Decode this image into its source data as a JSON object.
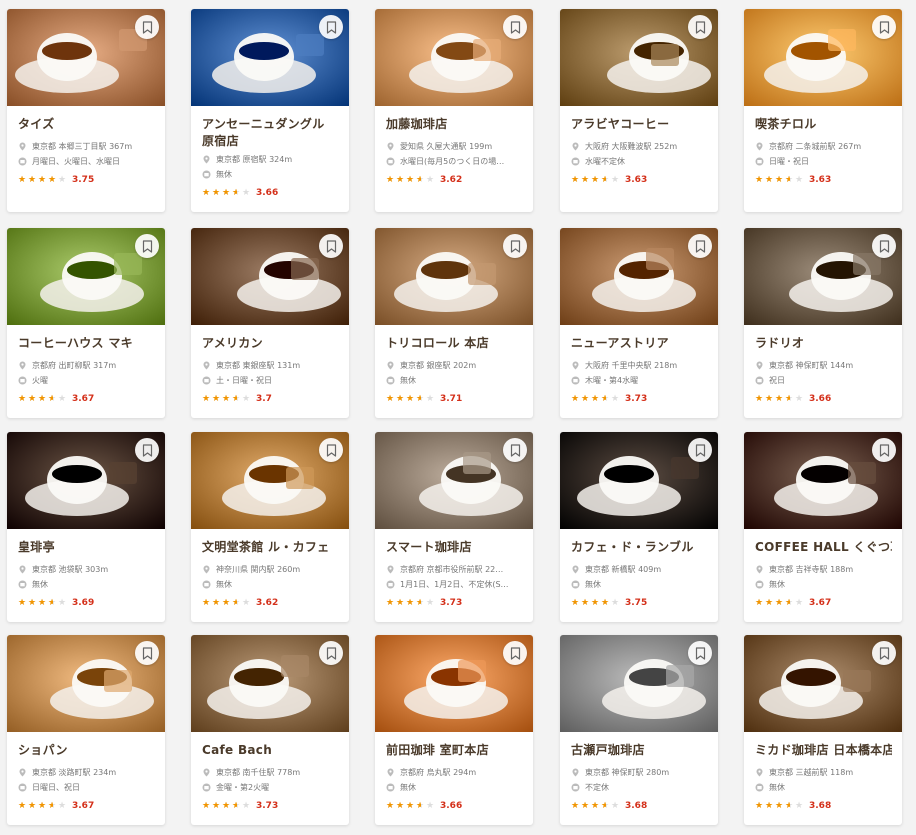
{
  "colors": {
    "star": "#f29500",
    "score": "#d4301a",
    "name": "#4a3a2a",
    "meta": "#777777"
  },
  "icons": {
    "location": "location-pin-icon",
    "holiday": "calendar-icon",
    "bookmark": "bookmark-icon",
    "star": "star-icon"
  },
  "shops": [
    {
      "name": "タイズ",
      "location": "東京都 本郷三丁目駅 367m",
      "holiday": "月曜日、火曜日、水曜日",
      "rating": 3.75,
      "rating_text": "3.75",
      "photo": "#b47a52"
    },
    {
      "name": "アンセーニュダングル 原宿店",
      "location": "東京都 原宿駅 324m",
      "holiday": "無休",
      "rating": 3.66,
      "rating_text": "3.66",
      "photo": "#2f5fa2"
    },
    {
      "name": "加藤珈琲店",
      "location": "愛知県 久屋大通駅 199m",
      "holiday": "水曜日(毎月5のつく日の場…",
      "rating": 3.62,
      "rating_text": "3.62",
      "photo": "#c98f5a"
    },
    {
      "name": "アラビヤコーヒー",
      "location": "大阪府 大阪難波駅 252m",
      "holiday": "水曜不定休",
      "rating": 3.63,
      "rating_text": "3.63",
      "photo": "#8a6a3c"
    },
    {
      "name": "喫茶チロル",
      "location": "京都府 二条城前駅 267m",
      "holiday": "日曜・祝日",
      "rating": 3.63,
      "rating_text": "3.63",
      "photo": "#e89a40"
    },
    {
      "name": "コーヒーハウス マキ",
      "location": "京都府 出町柳駅 317m",
      "holiday": "火曜",
      "rating": 3.67,
      "rating_text": "3.67",
      "photo": "#7a9a3a"
    },
    {
      "name": "アメリカン",
      "location": "東京都 東銀座駅 131m",
      "holiday": "土・日曜・祝日",
      "rating": 3.7,
      "rating_text": "3.7",
      "photo": "#6a4a32"
    },
    {
      "name": "トリコロール 本店",
      "location": "東京都 銀座駅 202m",
      "holiday": "無休",
      "rating": 3.71,
      "rating_text": "3.71",
      "photo": "#a57a52"
    },
    {
      "name": "ニューアストリア",
      "location": "大阪府 千里中央駅 218m",
      "holiday": "木曜・第4水曜",
      "rating": 3.73,
      "rating_text": "3.73",
      "photo": "#9a6a42"
    },
    {
      "name": "ラドリオ",
      "location": "東京都 神保町駅 144m",
      "holiday": "祝日",
      "rating": 3.66,
      "rating_text": "3.66",
      "photo": "#6a5a48"
    },
    {
      "name": "皇琲亭",
      "location": "東京都 池袋駅 303m",
      "holiday": "無休",
      "rating": 3.69,
      "rating_text": "3.69",
      "photo": "#3a2414"
    },
    {
      "name": "文明堂茶館 ル・カフェ",
      "location": "神奈川県 関内駅 260m",
      "holiday": "無休",
      "rating": 3.62,
      "rating_text": "3.62",
      "photo": "#b07a3a"
    },
    {
      "name": "スマート珈琲店",
      "location": "京都府 京都市役所前駅 22…",
      "holiday": "1月1日、1月2日、不定休(S…",
      "rating": 3.73,
      "rating_text": "3.73",
      "photo": "#8a7a6a"
    },
    {
      "name": "カフェ・ド・ランブル",
      "location": "東京都 新橋駅 409m",
      "holiday": "無休",
      "rating": 3.75,
      "rating_text": "3.75",
      "photo": "#2a1a10"
    },
    {
      "name": "COFFEE HALL くぐつ草",
      "location": "東京都 吉祥寺駅 188m",
      "holiday": "無休",
      "rating": 3.67,
      "rating_text": "3.67",
      "photo": "#4a3020"
    },
    {
      "name": "ショパン",
      "location": "東京都 淡路町駅 234m",
      "holiday": "日曜日、祝日",
      "rating": 3.67,
      "rating_text": "3.67",
      "photo": "#c08a50"
    },
    {
      "name": "Cafe Bach",
      "location": "東京都 南千住駅 778m",
      "holiday": "金曜・第2火曜",
      "rating": 3.73,
      "rating_text": "3.73",
      "photo": "#8a6a48"
    },
    {
      "name": "前田珈琲 室町本店",
      "location": "京都府 烏丸駅 294m",
      "holiday": "無休",
      "rating": 3.66,
      "rating_text": "3.66",
      "photo": "#d07a3a"
    },
    {
      "name": "古瀬戸珈琲店",
      "location": "東京都 神保町駅 280m",
      "holiday": "不定休",
      "rating": 3.68,
      "rating_text": "3.68",
      "photo": "#8a8a8a"
    },
    {
      "name": "ミカド珈琲店 日本橋本店",
      "location": "東京都 三越前駅 118m",
      "holiday": "無休",
      "rating": 3.68,
      "rating_text": "3.68",
      "photo": "#7a5a3a"
    }
  ]
}
